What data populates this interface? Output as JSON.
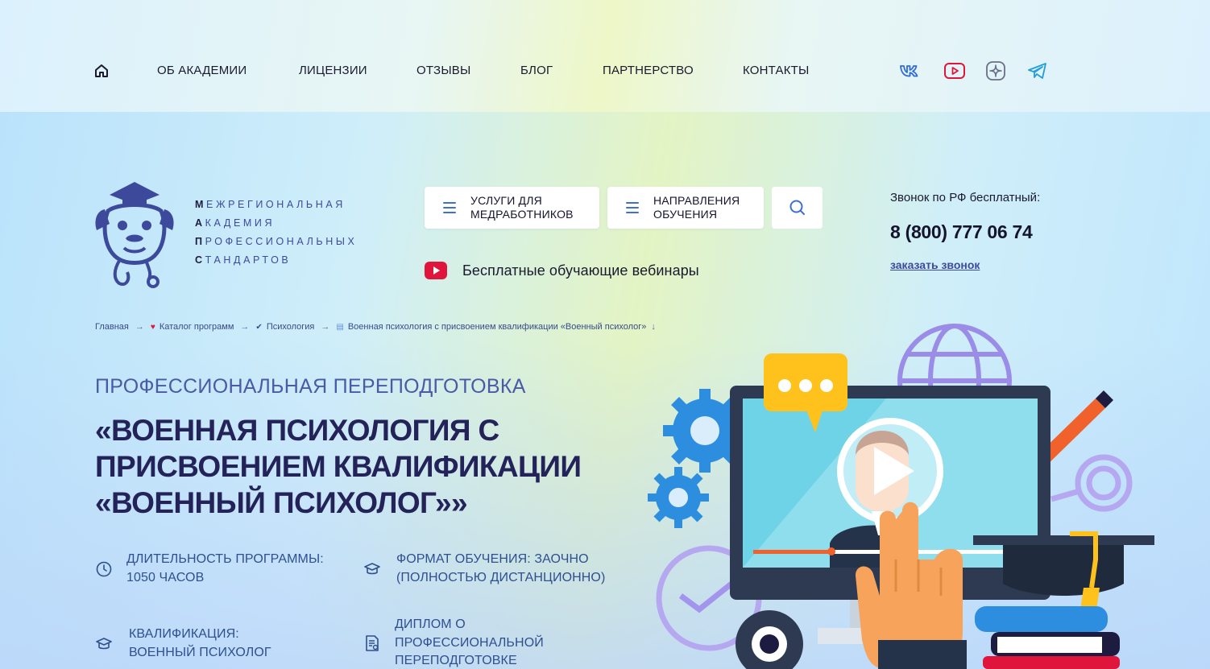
{
  "nav": {
    "items": [
      "ОБ АКАДЕМИИ",
      "ЛИЦЕНЗИИ",
      "ОТЗЫВЫ",
      "БЛОГ",
      "ПАРТНЕРСТВО",
      "КОНТАКТЫ"
    ],
    "social": [
      "vk-icon",
      "youtube-icon",
      "dzen-icon",
      "telegram-icon"
    ]
  },
  "logo": {
    "lines": [
      {
        "initial": "М",
        "rest": "ЕЖРЕГИОНАЛЬНАЯ"
      },
      {
        "initial": "А",
        "rest": "КАДЕМИЯ"
      },
      {
        "initial": "П",
        "rest": "РОФЕССИОНАЛЬНЫХ"
      },
      {
        "initial": "С",
        "rest": "ТАНДАРТОВ"
      }
    ]
  },
  "header": {
    "services_label_1": "УСЛУГИ ДЛЯ",
    "services_label_2": "МЕДРАБОТНИКОВ",
    "directions_label_1": "НАПРАВЛЕНИЯ",
    "directions_label_2": "ОБУЧЕНИЯ",
    "webinars_label": "Бесплатные обучающие вебинары",
    "call_caption": "Звонок по РФ бесплатный:",
    "phone": "8 (800) 777 06 74",
    "order_call": "заказать звонок"
  },
  "breadcrumbs": [
    "Главная",
    "Каталог программ",
    "Психология",
    "Военная психология с присвоением квалификации «Военный психолог»"
  ],
  "program": {
    "kicker": "ПРОФЕССИОНАЛЬНАЯ ПЕРЕПОДГОТОВКА",
    "title_1": "«ВОЕННАЯ ПСИХОЛОГИЯ С",
    "title_2": "ПРИСВОЕНИЕМ КВАЛИФИКАЦИИ",
    "title_3": "«ВОЕННЫЙ ПСИХОЛОГ»»",
    "facts": {
      "duration_1": "ДЛИТЕЛЬНОСТЬ ПРОГРАММЫ:",
      "duration_2": "1050 ЧАСОВ",
      "format_1": "ФОРМАТ ОБУЧЕНИЯ: ЗАОЧНО",
      "format_2": "(ПОЛНОСТЬЮ ДИСТАНЦИОННО)",
      "qual_1": "КВАЛИФИКАЦИЯ:",
      "qual_2": "ВОЕННЫЙ ПСИХОЛОГ",
      "diploma_1": "ДИПЛОМ О",
      "diploma_2": "ПРОФЕССИОНАЛЬНОЙ",
      "diploma_3": "ПЕРЕПОДГОТОВКЕ"
    }
  },
  "colors": {
    "accent_blue": "#3f6fd0",
    "title": "#23235a",
    "youtube_red": "#e0153c",
    "pencil_orange": "#f0612b"
  }
}
